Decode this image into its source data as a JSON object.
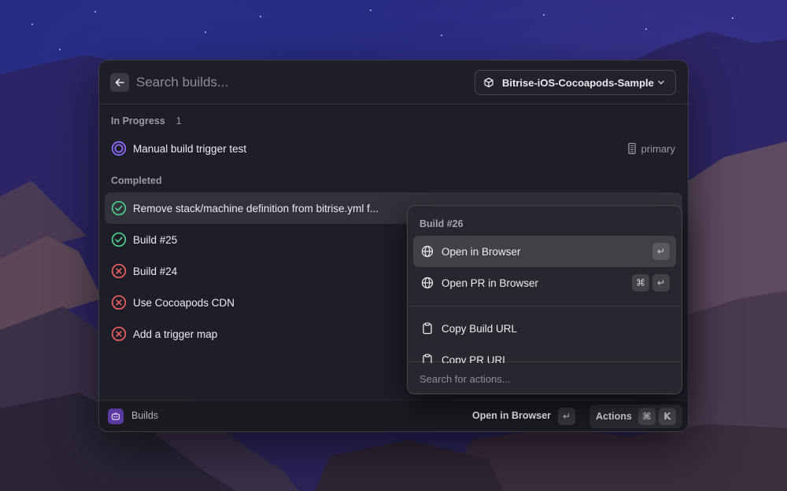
{
  "search": {
    "placeholder": "Search builds..."
  },
  "app_selector": {
    "label": "Bitrise-iOS-Cocoapods-Sample"
  },
  "sections": {
    "in_progress": {
      "title": "In Progress",
      "count": "1"
    },
    "completed": {
      "title": "Completed"
    }
  },
  "builds": {
    "in_progress": [
      {
        "title": "Manual build trigger test",
        "branch": "primary",
        "status": "in-progress"
      }
    ],
    "completed": [
      {
        "title": "Remove stack/machine definition from bitrise.yml f...",
        "status": "success"
      },
      {
        "title": "Build #25",
        "status": "success"
      },
      {
        "title": "Build #24",
        "status": "failed"
      },
      {
        "title": "Use Cocoapods CDN",
        "status": "failed"
      },
      {
        "title": "Add a trigger map",
        "status": "failed"
      }
    ]
  },
  "popover": {
    "title": "Build #26",
    "items": [
      {
        "label": "Open in Browser",
        "icon": "globe-icon",
        "keys": [
          "↵"
        ]
      },
      {
        "label": "Open PR in Browser",
        "icon": "globe-icon",
        "keys": [
          "⌘",
          "↵"
        ]
      },
      {
        "label": "Copy Build URL",
        "icon": "clipboard-icon",
        "keys": []
      },
      {
        "label": "Copy PR URL",
        "icon": "clipboard-icon",
        "keys": []
      }
    ],
    "search_placeholder": "Search for actions..."
  },
  "footer": {
    "app_name": "Builds",
    "primary_action": "Open in Browser",
    "primary_key": "↵",
    "actions_label": "Actions",
    "actions_keys": [
      "⌘",
      "K"
    ]
  },
  "colors": {
    "success": "#4fd08a",
    "failed": "#f0605d",
    "in_progress": "#8d6bff",
    "app_icon": "#5b3aa0"
  }
}
